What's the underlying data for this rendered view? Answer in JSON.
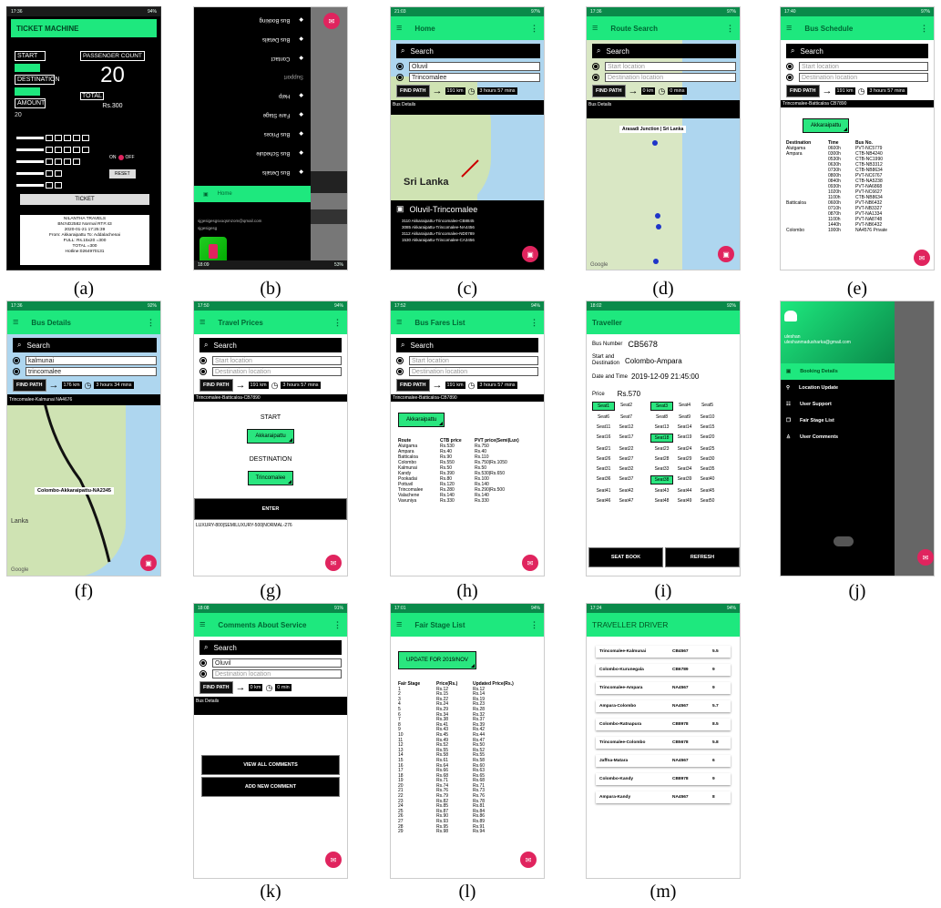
{
  "captions": [
    "(a)",
    "(b)",
    "(c)",
    "(d)",
    "(e)",
    "(f)",
    "(g)",
    "(h)",
    "(i)",
    "(j)",
    "(k)",
    "(l)",
    "(m)"
  ],
  "colors": {
    "accent": "#1ee87e",
    "fab": "#e0245e",
    "dark": "#000000"
  },
  "a": {
    "title": "TICKET MACHINE",
    "start": "START",
    "destination": "DESTINATION",
    "amount": "AMOUNT",
    "amount_val": "20",
    "pc": "PASSENGER COUNT",
    "pc_val": "20",
    "total": "TOTAL",
    "total_val": "Rs.300",
    "on": "ON",
    "off": "OFF",
    "reset": "RESET",
    "ticket": "TICKET",
    "receipt": [
      "NILANTHA TRAVELS",
      "BN:ND2582 Normal RT#:43",
      "2020-01-21 17:25:39",
      "From: Akkaraipattu To: Addalachenai",
      "FULL: Rs.15x20 =300",
      "TOTAL =300",
      "Hotline:0264970131"
    ]
  },
  "b": {
    "menu": [
      "Route Search",
      "Bus Details",
      "Bus Schedule",
      "Bus Prices",
      "Fare Stage",
      "Help"
    ],
    "active": "Home",
    "email": "sjgesigesgsxoqsmzom@qmail.com",
    "name": "sjgesigesg",
    "section": "Support",
    "m_pre": [
      "Contact",
      "Bus Details",
      "Bus Booking"
    ]
  },
  "c": {
    "title": "Home",
    "search": "Search",
    "from": "Oluvil",
    "to": "Trincomalee",
    "findpath": "FIND PATH",
    "dist": "191 km",
    "time": "3 hours 57 mins",
    "details": "Bus Details",
    "map_label": "Sri Lanka",
    "route": "Oluvil-Trincomalee",
    "buses": [
      "3110 Akkaraipattu-Trincomalee-CB8845",
      "3085 Akkaraipattu-Trincomalee-NA4456",
      "3112 Akkaraipattu-Trincomalee-ND0789",
      "1530 Akkaraipattu-Trincomalee-CA3456"
    ]
  },
  "d": {
    "title": "Route Search",
    "search": "Search",
    "from": "Start location",
    "to": "Destination location",
    "findpath": "FIND PATH",
    "dist": "0 km",
    "time": "0 mins",
    "details": "Bus Details",
    "pin": "Arasadi Junction | Sri Lanka",
    "google": "Google"
  },
  "e": {
    "title": "Bus Schedule",
    "search": "Search",
    "from": "Start location",
    "to": "Destination location",
    "findpath": "FIND PATH",
    "dist": "191 km",
    "time": "3 hours 57 mins",
    "route": "Trincomalee-Batticaloa CB7890",
    "select": "Akkaraipattu",
    "headers": [
      "Destination",
      "Time",
      "Bus No."
    ],
    "rows": [
      [
        "Alutgama",
        "0600h",
        "PVT-NC5779"
      ],
      [
        "Ampara",
        "0300h",
        "CTB-NB4240"
      ],
      [
        "",
        "0530h",
        "CTB-NC1990"
      ],
      [
        "",
        "0630h",
        "CTB-NB3312"
      ],
      [
        "",
        "0730h",
        "CTB-NB8634"
      ],
      [
        "",
        "0800h",
        "PVT-NC6767"
      ],
      [
        "",
        "0840h",
        "CTB-NA5238"
      ],
      [
        "",
        "0930h",
        "PVT-NA6868"
      ],
      [
        "",
        "1020h",
        "PVT-NC6627"
      ],
      [
        "",
        "1100h",
        "CTB-NB8634"
      ],
      [
        "Batticaloa",
        "0600h",
        "PVT-NB6432"
      ],
      [
        "",
        "0710h",
        "PVT-NB3327"
      ],
      [
        "",
        "0870h",
        "PVT-NA1334"
      ],
      [
        "",
        "1100h",
        "PVT-NA8748"
      ],
      [
        "",
        "1440h",
        "PVT-NB6432"
      ],
      [
        "Colombo",
        "1000h",
        "NA4576 Private"
      ]
    ]
  },
  "f": {
    "title": "Bus Details",
    "search": "Search",
    "from": "kalmunai",
    "to": "trincomalee",
    "findpath": "FIND PATH",
    "dist": "176 km",
    "time": "3 hours 34 mins",
    "route": "Trincomalee-Kalmunai NA4676",
    "map_label": "Colombo-Akkaraipattu-NA2345",
    "lanka": "Lanka",
    "google": "Google"
  },
  "g": {
    "title": "Travel Prices",
    "search": "Search",
    "from": "Start location",
    "to": "Destination location",
    "findpath": "FIND PATH",
    "dist": "191 km",
    "time": "3 hours 57 mins",
    "route": "Trincomalee-Batticaloa-CB7890",
    "start": "START",
    "start_val": "Akkaraipattu",
    "dest": "DESTINATION",
    "dest_val": "Trincomalee",
    "enter": "ENTER",
    "result": "LUXURY-800|SEMILUXURY-500|NORMAL-276"
  },
  "h": {
    "title": "Bus Fares List",
    "search": "Search",
    "from": "Start location",
    "to": "Destination location",
    "findpath": "FIND PATH",
    "dist": "191 km",
    "time": "3 hours 57 mins",
    "route": "Trincomalee-Batticaloa-CB7890",
    "select": "Akkaraipattu",
    "headers": [
      "Route",
      "CTB price",
      "PVT price(Semi|Lux)"
    ],
    "rows": [
      [
        "Alutgama",
        "Rs.530",
        "Rs.750"
      ],
      [
        "Ampara",
        "Rs.40",
        "Rs.40"
      ],
      [
        "Batticaloa",
        "Rs.90",
        "Rs.110"
      ],
      [
        "Colombo",
        "Rs.550",
        "Rs.750|Rs.1050"
      ],
      [
        "Kalmunai",
        "Rs.50",
        "Rs.50"
      ],
      [
        "Kandy",
        "Rs.390",
        "Rs.530|Rs.650"
      ],
      [
        "Pookadai",
        "Rs.80",
        "Rs.100"
      ],
      [
        "Pottuvil",
        "Rs.120",
        "Rs.140"
      ],
      [
        "Trincomalee",
        "Rs.280",
        "Rs.290|Rs.500"
      ],
      [
        "Valachene",
        "Rs.140",
        "Rs.140"
      ],
      [
        "Vavuniya",
        "Rs.330",
        "Rs.330"
      ]
    ]
  },
  "i": {
    "title": "Traveller",
    "bus_lbl": "Bus Number",
    "bus": "CB5678",
    "sd_lbl1": "Start and",
    "sd_lbl2": "Destination",
    "sd": "Colombo-Ampara",
    "dt_lbl": "Date and Time",
    "dt": "2019-12-09 21:45:00",
    "price_lbl": "Price",
    "price": "Rs.570",
    "seats": [
      [
        "Seat1",
        "Seat2",
        "Seat3",
        "Seat4",
        "Seat5"
      ],
      [
        "Seat6",
        "Seat7",
        "Seat8",
        "Seat9",
        "Seat10"
      ],
      [
        "Seat11",
        "Seat12",
        "Seat13",
        "Seat14",
        "Seat15"
      ],
      [
        "Seat16",
        "Seat17",
        "Seat18",
        "Seat19",
        "Seat20"
      ],
      [
        "Seat21",
        "Seat22",
        "Seat23",
        "Seat24",
        "Seat25"
      ],
      [
        "Seat26",
        "Seat27",
        "Seat28",
        "Seat29",
        "Seat30"
      ],
      [
        "Seat31",
        "Seat32",
        "Seat33",
        "Seat34",
        "Seat35"
      ],
      [
        "Seat36",
        "Seat37",
        "Seat38",
        "Seat39",
        "Seat40"
      ],
      [
        "Seat41",
        "Seat42",
        "Seat43",
        "Seat44",
        "Seat45"
      ],
      [
        "Seat46",
        "Seat47",
        "Seat48",
        "Seat49",
        "Seat50"
      ]
    ],
    "green": [
      "Seat1",
      "Seat3",
      "Seat18",
      "Seat38"
    ],
    "seatbook": "SEAT BOOK",
    "refresh": "REFRESH"
  },
  "j": {
    "name": "uleshan",
    "email": "uleshanmadusharka@gmail.com",
    "menu": [
      "Booking Details",
      "Location Update",
      "User Support",
      "Fair Stage List",
      "User Comments"
    ]
  },
  "k": {
    "title": "Comments About Service",
    "search": "Search",
    "from": "Oluvil",
    "to": "Destination location",
    "findpath": "FIND PATH",
    "dist": "0 km",
    "time": "0 min",
    "details": "Bus Details",
    "view": "VIEW ALL COMMENTS",
    "add": "ADD NEW COMMENT"
  },
  "l": {
    "title": "Fair Stage List",
    "update": "UPDATE FOR 2019/NOV",
    "headers": [
      "Fair Stage",
      "Price(Rs.)",
      "Updated Price(Rs.)"
    ],
    "rows": [
      [
        "1",
        "Rs.12",
        "Rs.12"
      ],
      [
        "2",
        "Rs.15",
        "Rs.14"
      ],
      [
        "3",
        "Rs.22",
        "Rs.19"
      ],
      [
        "4",
        "Rs.24",
        "Rs.23"
      ],
      [
        "5",
        "Rs.29",
        "Rs.28"
      ],
      [
        "6",
        "Rs.34",
        "Rs.32"
      ],
      [
        "7",
        "Rs.38",
        "Rs.37"
      ],
      [
        "8",
        "Rs.41",
        "Rs.39"
      ],
      [
        "9",
        "Rs.43",
        "Rs.42"
      ],
      [
        "10",
        "Rs.45",
        "Rs.44"
      ],
      [
        "11",
        "Rs.49",
        "Rs.47"
      ],
      [
        "12",
        "Rs.52",
        "Rs.50"
      ],
      [
        "13",
        "Rs.55",
        "Rs.52"
      ],
      [
        "14",
        "Rs.58",
        "Rs.55"
      ],
      [
        "15",
        "Rs.61",
        "Rs.58"
      ],
      [
        "16",
        "Rs.64",
        "Rs.60"
      ],
      [
        "17",
        "Rs.66",
        "Rs.63"
      ],
      [
        "18",
        "Rs.68",
        "Rs.65"
      ],
      [
        "19",
        "Rs.71",
        "Rs.68"
      ],
      [
        "20",
        "Rs.74",
        "Rs.71"
      ],
      [
        "21",
        "Rs.76",
        "Rs.73"
      ],
      [
        "22",
        "Rs.79",
        "Rs.76"
      ],
      [
        "23",
        "Rs.82",
        "Rs.78"
      ],
      [
        "24",
        "Rs.85",
        "Rs.81"
      ],
      [
        "25",
        "Rs.87",
        "Rs.84"
      ],
      [
        "26",
        "Rs.90",
        "Rs.86"
      ],
      [
        "27",
        "Rs.93",
        "Rs.89"
      ],
      [
        "28",
        "Rs.95",
        "Rs.91"
      ],
      [
        "29",
        "Rs.98",
        "Rs.94"
      ]
    ]
  },
  "m": {
    "title": "TRAVELLER DRIVER",
    "rows": [
      [
        "Trincomalee-Kalmunai",
        "CB4567",
        "5.5"
      ],
      [
        "Colombo-Kurunegala",
        "CB6789",
        "9"
      ],
      [
        "Trincomalee-Ampara",
        "NA4567",
        "9"
      ],
      [
        "Ampara-Colombo",
        "NA4567",
        "5.7"
      ],
      [
        "Colombo-Ratnapura",
        "CB8978",
        "8.5"
      ],
      [
        "Trincomalee-Colombo",
        "CB5678",
        "5.8"
      ],
      [
        "Jaffna-Matara",
        "NA4567",
        "6"
      ],
      [
        "Colombo-Kandy",
        "CB8978",
        "9"
      ],
      [
        "Ampara-Kandy",
        "NA4567",
        "8"
      ]
    ]
  }
}
